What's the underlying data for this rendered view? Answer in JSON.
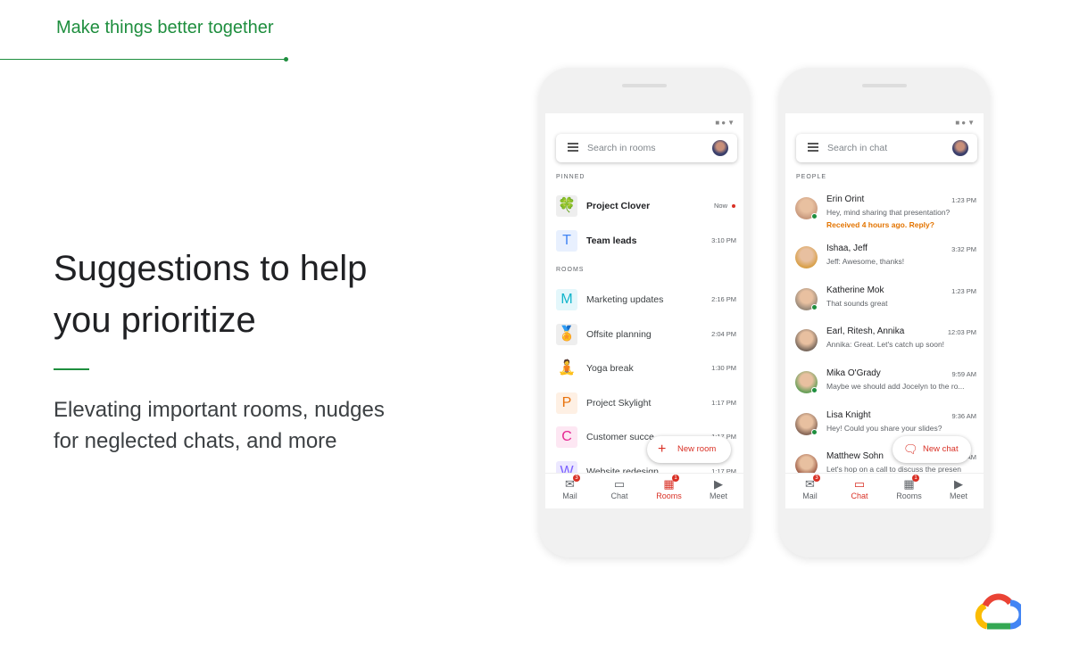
{
  "tagline": "Make things better together",
  "headline": "Suggestions to help you prioritize",
  "subtext": "Elevating important rooms, nudges for neglected chats, and more",
  "colors": {
    "accent_green": "#1e8e3e",
    "accent_red": "#d93025",
    "nudge_orange": "#e37400"
  },
  "rooms_phone": {
    "search_placeholder": "Search in rooms",
    "pinned_label": "PINNED",
    "rooms_label": "ROOMS",
    "pinned": [
      {
        "name": "Project Clover",
        "time": "Now",
        "icon": "clover-icon",
        "glyph": "🍀",
        "unread": true
      },
      {
        "name": "Team leads",
        "time": "3:10 PM",
        "icon": "letter-avatar",
        "glyph": "T",
        "color": "#4285f4",
        "bg": "#e8f0fe"
      }
    ],
    "rooms": [
      {
        "name": "Marketing updates",
        "time": "2:16 PM",
        "glyph": "M",
        "color": "#12b5cb",
        "bg": "#e4f7fb"
      },
      {
        "name": "Offsite planning",
        "time": "2:04 PM",
        "glyph": "🏅",
        "icon": "ribbon-icon",
        "bg": "#eee"
      },
      {
        "name": "Yoga break",
        "time": "1:30 PM",
        "glyph": "🧘",
        "icon": "yoga-icon",
        "bg": "#fff"
      },
      {
        "name": "Project Skylight",
        "time": "1:17 PM",
        "glyph": "P",
        "color": "#e8710a",
        "bg": "#fef0e4"
      },
      {
        "name": "Customer succe",
        "time": "1:17 PM",
        "glyph": "C",
        "color": "#e52592",
        "bg": "#fde7f3"
      },
      {
        "name": "Website redesign",
        "time": "1:17 PM",
        "glyph": "W",
        "color": "#7b61ff",
        "bg": "#ece8ff"
      }
    ],
    "fab_label": "New room",
    "nav": [
      {
        "label": "Mail",
        "badge": "3"
      },
      {
        "label": "Chat"
      },
      {
        "label": "Rooms",
        "badge": "1",
        "active": true
      },
      {
        "label": "Meet"
      }
    ]
  },
  "chat_phone": {
    "search_placeholder": "Search in chat",
    "people_label": "PEOPLE",
    "chats": [
      {
        "name": "Erin Orint",
        "time": "1:23 PM",
        "msg": "Hey, mind sharing that presentation?",
        "note": "Received 4 hours ago. Reply?",
        "online": true,
        "avatar": "#c99a7e"
      },
      {
        "name": "Ishaa, Jeff",
        "time": "3:32 PM",
        "msg": "Jeff: Awesome, thanks!",
        "online": false,
        "avatar": "#d8a04a"
      },
      {
        "name": "Katherine Mok",
        "time": "1:23 PM",
        "msg": "That sounds great",
        "online": true,
        "avatar": "#9a8a7a"
      },
      {
        "name": "Earl, Ritesh, Annika",
        "time": "12:03 PM",
        "msg": "Annika: Great. Let's catch up soon!",
        "online": false,
        "avatar": "#7a6a5e"
      },
      {
        "name": "Mika O'Grady",
        "time": "9:59 AM",
        "msg": "Maybe we should add Jocelyn to the ro...",
        "online": true,
        "avatar": "#6aa05a"
      },
      {
        "name": "Lisa Knight",
        "time": "9:36 AM",
        "msg": "Hey! Could you share your slides?",
        "online": true,
        "avatar": "#8a6a5a"
      },
      {
        "name": "Matthew Sohn",
        "time": "9:12 AM",
        "msg": "Let's hop on a call to discuss the presen",
        "online": false,
        "avatar": "#a0604a"
      }
    ],
    "fab_label": "New chat",
    "nav": [
      {
        "label": "Mail",
        "badge": "3"
      },
      {
        "label": "Chat",
        "active": true
      },
      {
        "label": "Rooms",
        "badge": "1"
      },
      {
        "label": "Meet"
      }
    ]
  }
}
